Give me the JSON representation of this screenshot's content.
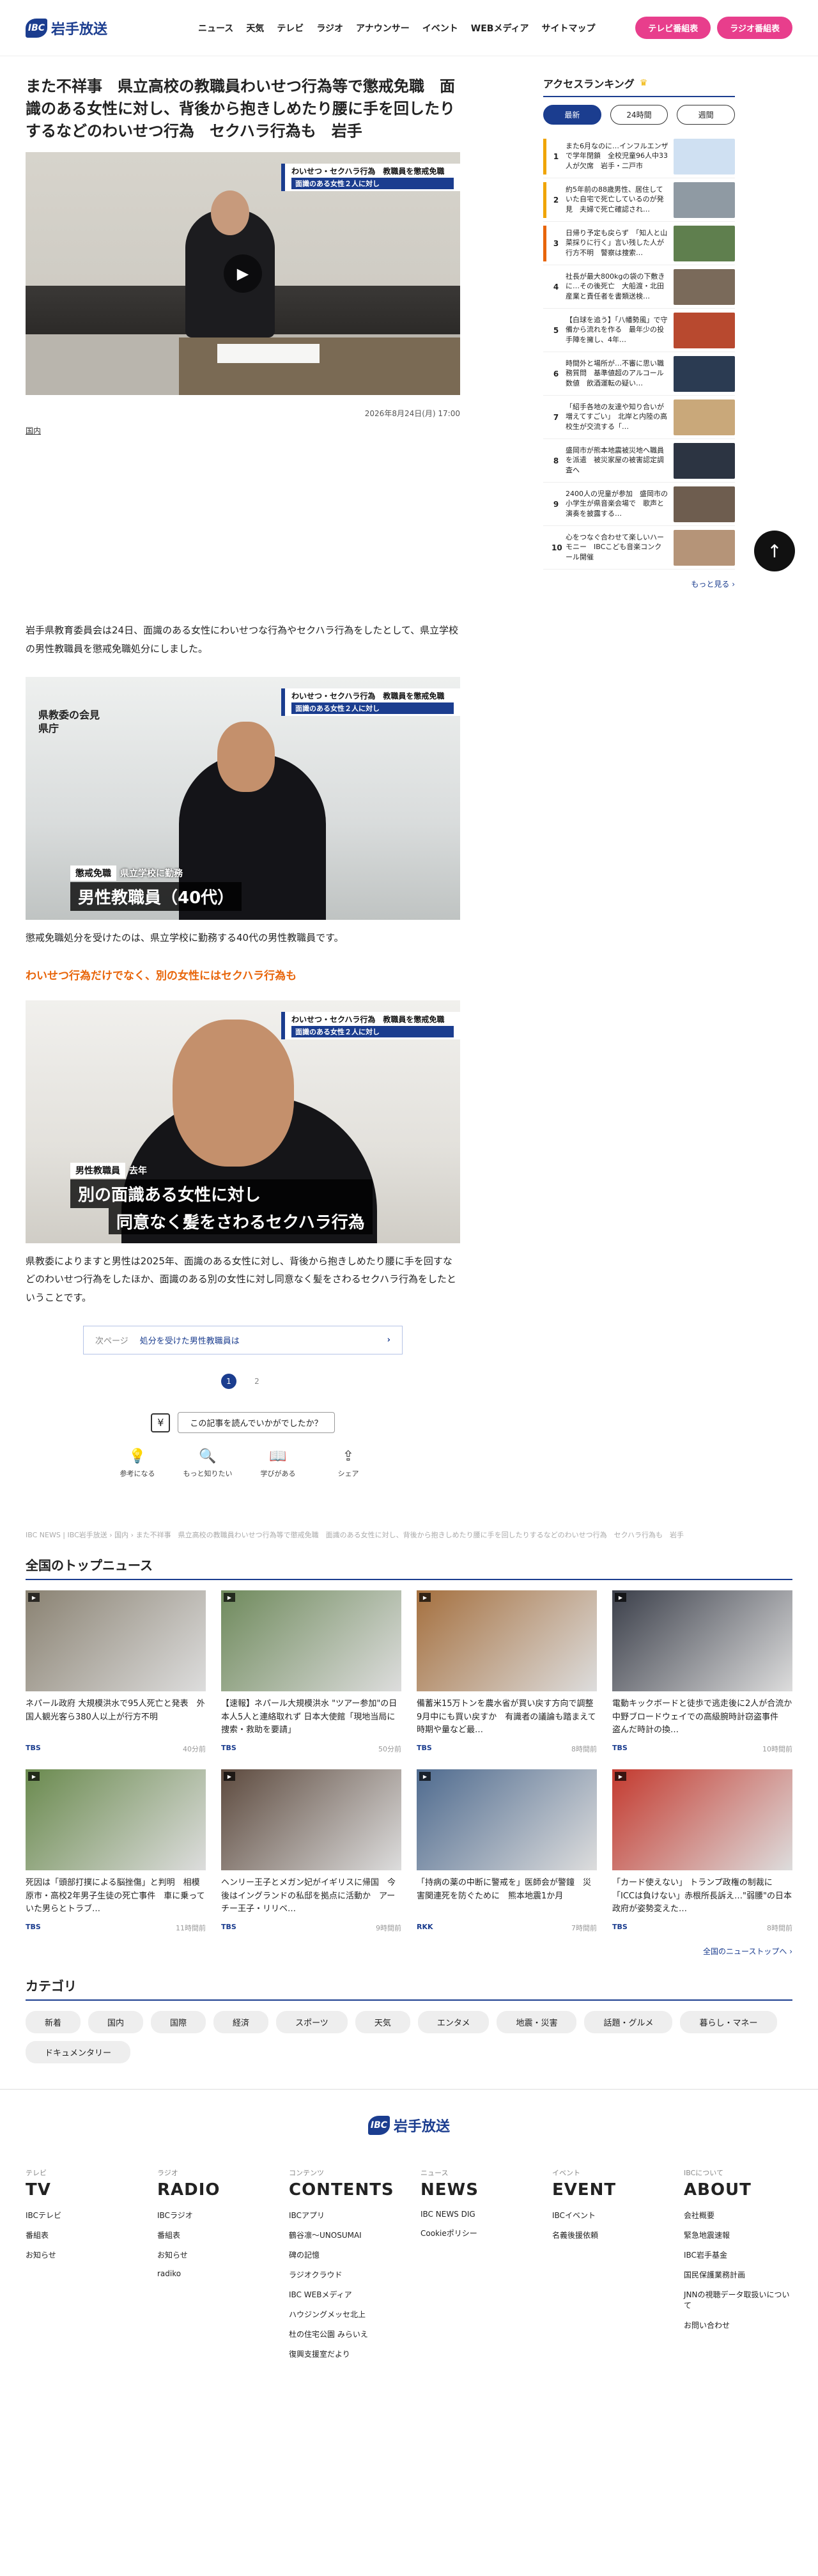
{
  "header": {
    "logo_mark": "IBC",
    "logo_text": "岩手放送",
    "nav": [
      "ニュース",
      "天気",
      "テレビ",
      "ラジオ",
      "アナウンサー",
      "イベント",
      "WEBメディア",
      "サイトマップ"
    ],
    "btn_tv": "テレビ番組表",
    "btn_radio": "ラジオ番組表"
  },
  "article": {
    "title": "また不祥事　県立高校の教職員わいせつ行為等で懲戒免職　面識のある女性に対し、背後から抱きしめたり腰に手を回したりするなどのわいせつ行為　セクハラ行為も　岩手",
    "banner": "わいせつ・セクハラ行為　教職員を懲戒免職",
    "banner_sub": "面識のある女性２人に対し",
    "date": "2026年8月24日(月) 17:00",
    "category": "国内",
    "p1": "岩手県教育委員会は24日、面識のある女性にわいせつな行為やセクハラ行為をしたとして、県立学校の男性教職員を懲戒免職処分にしました。",
    "photo2_loc1": "県教委の会見",
    "photo2_loc2": "県庁",
    "photo2_lab": "懲戒免職",
    "photo2_lab2": "県立学校に勤務",
    "photo2_big": "男性教職員（40代）",
    "p2": "懲戒免職処分を受けたのは、県立学校に勤務する40代の男性教職員です。",
    "subhead": "わいせつ行為だけでなく、別の女性にはセクハラ行為も",
    "photo3_lab": "男性教職員",
    "photo3_lab2": "去年",
    "photo3_big1": "別の面識ある女性に対し",
    "photo3_big2": "同意なく髪をさわるセクハラ行為",
    "p3": "県教委によりますと男性は2025年、面識のある女性に対し、背後から抱きしめたり腰に手を回すなどのわいせつ行為をしたほか、面識のある別の女性に対し同意なく髪をさわるセクハラ行為をしたということです。",
    "next_label": "次ページ",
    "next_title": "処分を受けた男性教職員は",
    "next_arrow": "›",
    "pages": [
      "1",
      "2"
    ],
    "feedback_q": "この記事を読んでいかがでしたか？",
    "reactions": [
      {
        "icon": "💡",
        "label": "参考になる"
      },
      {
        "icon": "🔍",
        "label": "もっと知りたい"
      },
      {
        "icon": "📖",
        "label": "学びがある"
      },
      {
        "icon": "⇪",
        "label": "シェア"
      }
    ],
    "play_icon": "▶",
    "feed_icon": "¥"
  },
  "ranking": {
    "title": "アクセスランキング",
    "crown": "♛",
    "tabs": [
      "最新",
      "24時間",
      "週間"
    ],
    "items": [
      {
        "n": "1",
        "text": "また6月なのに…インフルエンザで学年閉鎖　全校児童96人中33人が欠席　岩手・二戸市",
        "color": "#f0a500",
        "thumb": "#cfe0f2"
      },
      {
        "n": "2",
        "text": "約5年前の88歳男性、居住していた自宅で死亡しているのが発見　夫婦で死亡確認され…",
        "color": "#f0a500",
        "thumb": "#8f9aa3"
      },
      {
        "n": "3",
        "text": "日帰り予定も戻らず　「知人と山菜採りに行く」言い残した人が行方不明　警察は捜索…",
        "color": "#e8650a",
        "thumb": "#5f7f4e"
      },
      {
        "n": "4",
        "text": "社長が最大800kgの袋の下敷きに…その後死亡　大船渡・北田産業と責任者を書類送検…",
        "color": "#fff",
        "thumb": "#7a6a5a"
      },
      {
        "n": "5",
        "text": "【白球を追う】「八幡勢風」で守備から流れを作る　最年少の投手陣を擁し、4年…",
        "color": "#fff",
        "thumb": "#b8492f"
      },
      {
        "n": "6",
        "text": "時間外と場所が…不審に思い職務質問　基準値超のアルコール数値　飲酒運転の疑い…",
        "color": "#fff",
        "thumb": "#2b3b52"
      },
      {
        "n": "7",
        "text": "「紹手各地の友達や知り合いが増えてすごい」　北岸と内陸の高校生が交流する「…",
        "color": "#fff",
        "thumb": "#c9a87a"
      },
      {
        "n": "8",
        "text": "盛岡市が熊本地震被災地へ職員を派遣　被災家屋の被害認定調査へ",
        "color": "#fff",
        "thumb": "#2c3442"
      },
      {
        "n": "9",
        "text": "2400人の児童が参加　盛岡市の小学生が県音楽会場で　歌声と演奏を披露する…",
        "color": "#fff",
        "thumb": "#6e5d4f"
      },
      {
        "n": "10",
        "text": "心をつなぐ合わせて楽しいハーモニー　IBCこども音楽コンクール開催",
        "color": "#fff",
        "thumb": "#b59478"
      }
    ],
    "more": "もっと見る ›",
    "totop": "↑"
  },
  "breadcrumb": "IBC NEWS | IBC岩手放送 › 国内 › また不祥事　県立高校の教職員わいせつ行為等で懲戒免職　面識のある女性に対し、背後から抱きしめたり腰に手を回したりするなどのわいせつ行為　セクハラ行為も　岩手",
  "topnews": {
    "title": "全国のトップニュース",
    "cards": [
      {
        "text": "ネパール政府 大規模洪水で95人死亡と発表　外国人観光客ら380人以上が行方不明",
        "src": "TBS",
        "time": "40分前",
        "color": "#8a8272"
      },
      {
        "text": "【速報】ネパール大規模洪水 \"ツアー参加\"の日本人5人と連絡取れず 日本大使館「現地当局に捜索・救助を要請」",
        "src": "TBS",
        "time": "50分前",
        "color": "#6f8a5c"
      },
      {
        "text": "備蓄米15万トンを農水省が買い戻す方向で調整　9月中にも買い戻すか　有識者の議論も踏まえて時期や量など最…",
        "src": "TBS",
        "time": "8時間前",
        "color": "#a5703f"
      },
      {
        "text": "電動キックボードと徒歩で逃走後に2人が合流か　中野ブロードウェイでの高級腕時計窃盗事件　盗んだ時計の換…",
        "src": "TBS",
        "time": "10時間前",
        "color": "#3b3f4a"
      },
      {
        "text": "死因は「頭部打撲による脳挫傷」と判明　相模原市・高校2年男子生徒の死亡事件　車に乗っていた男らとトラブ…",
        "src": "TBS",
        "time": "11時間前",
        "color": "#6a8a4e"
      },
      {
        "text": "ヘンリー王子とメガン妃がイギリスに帰国　今後はイングランドの私邸を拠点に活動か　アーチー王子・リリベ…",
        "src": "TBS",
        "time": "9時間前",
        "color": "#5d4a3e"
      },
      {
        "text": "「持病の薬の中断に警戒を」医師会が警鐘　災害関連死を防ぐために　熊本地震1か月",
        "src": "RKK",
        "time": "7時間前",
        "color": "#4f6b8f"
      },
      {
        "text": "「カード使えない」 トランプ政権の制裁に「ICCは負けない」赤根所長訴え…\"弱腰\"の日本政府が姿勢変えた…",
        "src": "TBS",
        "time": "8時間前",
        "color": "#c43a2f"
      }
    ],
    "more": "全国のニューストップへ ›",
    "vi": "▶"
  },
  "categories": {
    "title": "カテゴリ",
    "items": [
      "新着",
      "国内",
      "国際",
      "経済",
      "スポーツ",
      "天気",
      "エンタメ",
      "地震・災害",
      "話題・グルメ",
      "暮らし・マネー",
      "ドキュメンタリー"
    ]
  },
  "footer": {
    "logo_mark": "IBC",
    "logo_text": "岩手放送",
    "cols": [
      {
        "s": "テレビ",
        "b": "TV",
        "items": [
          "IBCテレビ",
          "番組表",
          "お知らせ"
        ]
      },
      {
        "s": "ラジオ",
        "b": "RADIO",
        "items": [
          "IBCラジオ",
          "番組表",
          "お知らせ",
          "radiko"
        ]
      },
      {
        "s": "コンテンツ",
        "b": "CONTENTS",
        "items": [
          "IBCアプリ",
          "鶴谷凛～UNOSUMAI",
          "碑の記憶",
          "ラジオクラウド",
          "IBC WEBメディア",
          "ハウジングメッセ北上",
          "杜の住宅公園 みらいえ",
          "復興支援室だより"
        ]
      },
      {
        "s": "ニュース",
        "b": "NEWS",
        "items": [
          "IBC NEWS DIG",
          "Cookieポリシー"
        ]
      },
      {
        "s": "イベント",
        "b": "EVENT",
        "items": [
          "IBCイベント",
          "名義後援依頼"
        ]
      },
      {
        "s": "IBCについて",
        "b": "ABOUT",
        "items": [
          "会社概要",
          "緊急地震速報",
          "IBC岩手基金",
          "国民保護業務計画",
          "JNNの視聴データ取扱いについて",
          "お問い合わせ"
        ]
      }
    ]
  }
}
